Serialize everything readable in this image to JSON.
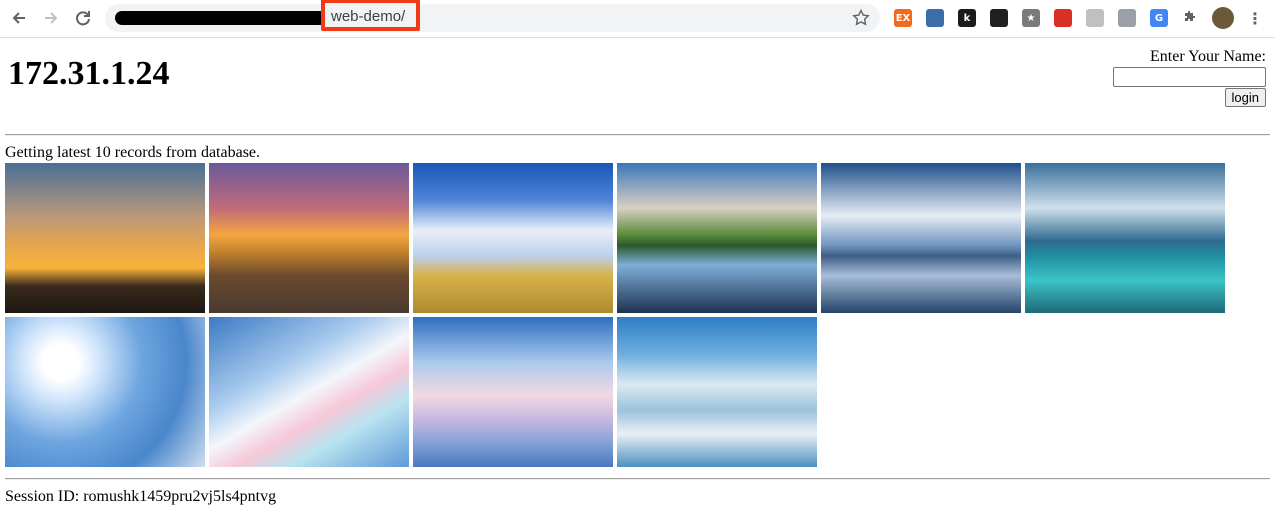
{
  "browser": {
    "url_visible": "web-demo/",
    "extensions": [
      {
        "name": "ex-extension-icon",
        "label": "EX",
        "color": "#f26b1d"
      },
      {
        "name": "blue-extension-icon",
        "label": "",
        "color": "#3b6ea8"
      },
      {
        "name": "k-extension-icon",
        "label": "k",
        "color": "#1c1c1c"
      },
      {
        "name": "dark-extension-icon",
        "label": "",
        "color": "#202020"
      },
      {
        "name": "star-box-extension-icon",
        "label": "★",
        "color": "#7a7a7a"
      },
      {
        "name": "red-dot-extension-icon",
        "label": "",
        "color": "#d93025"
      },
      {
        "name": "gray-extension-icon",
        "label": "",
        "color": "#c0c0c0"
      },
      {
        "name": "globe-extension-icon",
        "label": "",
        "color": "#9aa0a6"
      },
      {
        "name": "translate-extension-icon",
        "label": "G",
        "color": "#4285f4"
      }
    ]
  },
  "page": {
    "title": "172.31.1.24",
    "login_label": "Enter Your Name:",
    "login_input_value": "",
    "login_button": "login",
    "status": "Getting latest 10 records from database.",
    "session": "Session ID: romushk1459pru2vj5ls4pntvg"
  },
  "gallery": [
    {
      "name": "photo-sunset-clouds",
      "bg": "linear-gradient(180deg,#4a6f96 0%,#b9987a 35%,#e7a54e 55%,#f7b33a 70%,#3a2a1c 82%,#1d1712 100%)"
    },
    {
      "name": "photo-beach-sunset",
      "bg": "linear-gradient(180deg,#6a5a9a 0%,#c06b7a 30%,#f4a540 48%,#c9862c 58%,#6b4a2e 75%,#4a3a30 100%)"
    },
    {
      "name": "photo-road-sky",
      "bg": "linear-gradient(180deg,#1a56b8 0%,#4f86d8 25%,#e9eff8 45%,#bcd0ea 62%,#d6b24a 75%,#b08a2e 100%)"
    },
    {
      "name": "photo-lake-reflection",
      "bg": "linear-gradient(180deg,#3a77b8 0%,#d8d0c4 30%,#5a8a3a 48%,#2a5a2a 55%,#7eaed8 68%,#1d3350 100%)"
    },
    {
      "name": "photo-pier-clouds",
      "bg": "linear-gradient(180deg,#1f4f8a 0%,#e6edf4 35%,#6f94bd 55%,#3d5f86 62%,#a8bed8 75%,#24446a 100%)"
    },
    {
      "name": "photo-turquoise-sea",
      "bg": "linear-gradient(180deg,#3a6f9a 0%,#cfe0ea 30%,#2f6a8f 52%,#1f8fa0 62%,#3cc3c8 78%,#1d6a76 100%)"
    },
    {
      "name": "photo-sun-rays",
      "bg": "radial-gradient(circle at 28% 30%,#ffffff 0%,#ffffff 10%,#cfe4fb 22%,#6fa6e0 45%,#4a86cc 70%,#cfdff0 100%)"
    },
    {
      "name": "photo-rainbow-clouds",
      "bg": "linear-gradient(150deg,#3c7ac4 0%,#a9cbee 35%,#f3f6fb 50%,#f6c8d8 62%,#b9e3f0 74%,#5f9ad8 100%)"
    },
    {
      "name": "photo-pastel-clouds",
      "bg": "linear-gradient(180deg,#2e6fbf 0%,#a9c9ec 30%,#f2d9e2 52%,#c7b8e0 68%,#7fa0d6 85%,#4c76c0 100%)"
    },
    {
      "name": "photo-cloud-mountains",
      "bg": "linear-gradient(180deg,#2f7ec4 0%,#6eaee0 25%,#dce9f2 45%,#9cc2dc 62%,#e8f0f4 78%,#4d8fbf 100%)"
    }
  ]
}
